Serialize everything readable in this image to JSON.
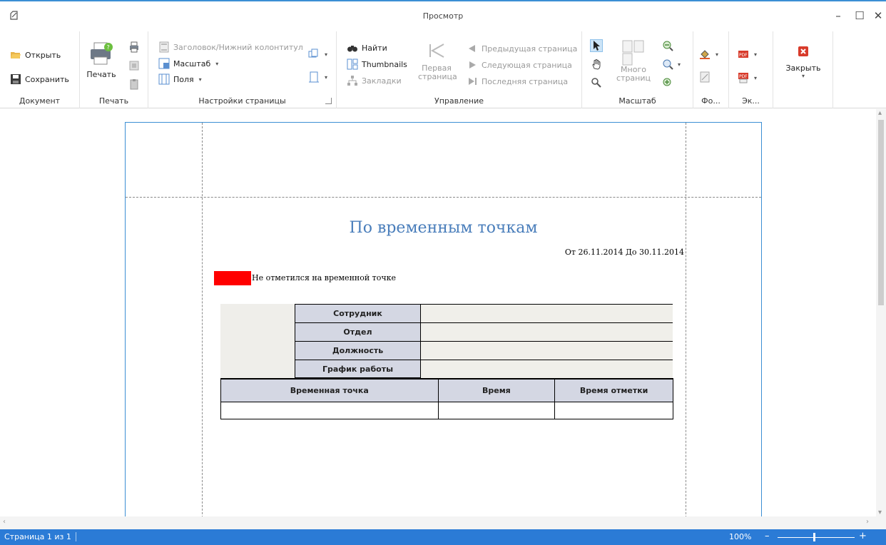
{
  "window": {
    "title": "Просмотр",
    "minimize": "–",
    "maximize": "☐",
    "close": "✕"
  },
  "ribbon": {
    "document": {
      "label": "Документ",
      "open": "Открыть",
      "save": "Сохранить"
    },
    "print": {
      "label": "Печать",
      "print_button": "Печать"
    },
    "page_setup": {
      "label": "Настройки страницы",
      "header_footer": "Заголовок/Нижний колонтитул",
      "scale": "Масштаб",
      "margins": "Поля"
    },
    "navigation": {
      "label": "Управление",
      "find": "Найти",
      "thumbnails": "Thumbnails",
      "bookmarks": "Закладки",
      "first_page_line1": "Первая",
      "first_page_line2": "страница",
      "prev_page": "Предыдущая страница",
      "next_page": "Следующая страница",
      "last_page": "Последняя страница"
    },
    "zoom": {
      "label": "Масштаб",
      "many_pages_line1": "Много",
      "many_pages_line2": "страниц"
    },
    "background": {
      "label": "Фо..."
    },
    "export": {
      "label": "Эк..."
    },
    "close": {
      "label": "Закрыть"
    }
  },
  "report": {
    "title": "По временным точкам",
    "date_range": "От 26.11.2014 До 30.11.2014",
    "legend_text": "Не отметился на временной точке",
    "legend_color": "#ff0000",
    "employee_fields": [
      "Сотрудник",
      "Отдел",
      "Должность",
      "График работы"
    ],
    "table_headers": [
      "Временная точка",
      "Время",
      "Время отметки"
    ]
  },
  "status": {
    "page_info": "Страница 1 из 1",
    "zoom": "100%",
    "zoom_minus": "–",
    "zoom_plus": "+",
    "accent": "#2b7bd6"
  }
}
